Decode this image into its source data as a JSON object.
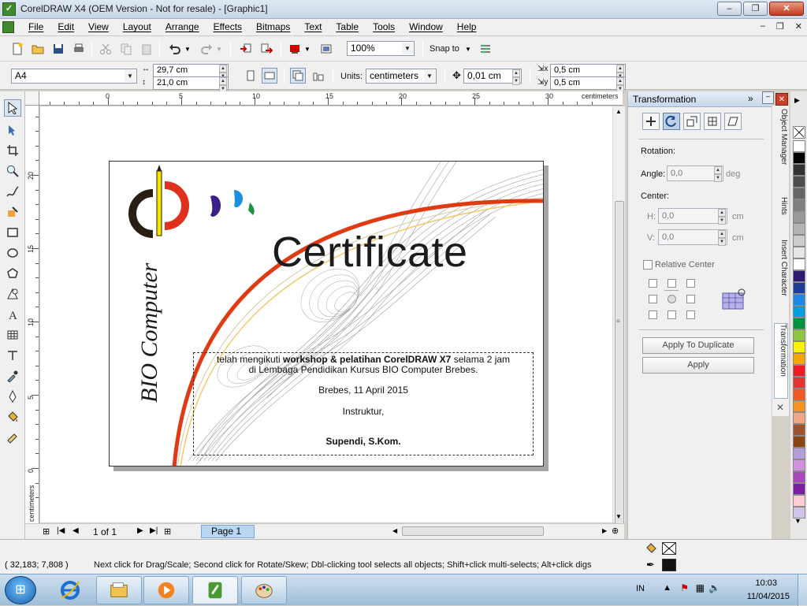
{
  "window": {
    "title": "CorelDRAW X4 (OEM Version - Not for resale) - [Graphic1]",
    "app_icon": "corel-logo-icon"
  },
  "menu": {
    "items": [
      "File",
      "Edit",
      "View",
      "Layout",
      "Arrange",
      "Effects",
      "Bitmaps",
      "Text",
      "Table",
      "Tools",
      "Window",
      "Help"
    ]
  },
  "toolbar": {
    "zoom": "100%",
    "snap_label": "Snap to"
  },
  "property_bar": {
    "paper": "A4",
    "width": "29,7 cm",
    "height": "21,0 cm",
    "units_label": "Units:",
    "units": "centimeters",
    "nudge": "0,01 cm",
    "dup_x": "0,5 cm",
    "dup_y": "0,5 cm"
  },
  "rulers": {
    "h_ticks": [
      "0",
      "5",
      "10",
      "15",
      "20",
      "25",
      "30"
    ],
    "v_ticks": [
      "20",
      "15",
      "10",
      "5",
      "0"
    ],
    "unit": "centimeters"
  },
  "certificate": {
    "logo_text": "BIO Computer",
    "heading": "Certificate",
    "line1_pre": "telah mengikuti ",
    "line1_bold": "workshop & pelatihan CorelDRAW X7",
    "line1_post": " selama 2 jam",
    "line2": "di Lembaga Pendidikan Kursus BIO Computer Brebes.",
    "place_date": "Brebes, 11 April 2015",
    "role": "Instruktur,",
    "signer": "Supendi, S.Kom."
  },
  "page_nav": {
    "counter": "1 of 1",
    "tab": "Page 1"
  },
  "docker": {
    "title": "Transformation",
    "rotation_label": "Rotation:",
    "angle_label": "Angle:",
    "angle_value": "0,0",
    "angle_unit": "deg",
    "center_label": "Center:",
    "h_label": "H:",
    "h_value": "0,0",
    "h_unit": "cm",
    "v_label": "V:",
    "v_value": "0,0",
    "v_unit": "cm",
    "relative_center": "Relative Center",
    "apply_dup": "Apply To Duplicate",
    "apply": "Apply"
  },
  "side_tabs": [
    "Object Manager",
    "Hints",
    "Insert Character",
    "Transformation"
  ],
  "palette": [
    "#ffffff",
    "#000000",
    "#333333",
    "#4d4d4d",
    "#666666",
    "#808080",
    "#999999",
    "#b3b3b3",
    "#cccccc",
    "#e6e6e6",
    "#ffffff",
    "#2e1a6e",
    "#1f3c96",
    "#1e88e5",
    "#00a0e0",
    "#00923f",
    "#8dc63f",
    "#fff200",
    "#f7a600",
    "#ed1c24",
    "#e3342f",
    "#f15a24",
    "#f7931e",
    "#f4a582",
    "#a0522d",
    "#8b4513",
    "#b39ddb",
    "#ce93d8",
    "#ab47bc",
    "#7b1fa2",
    "#ffcdd2",
    "#d1c4e9"
  ],
  "status": {
    "coords": "( 32,183; 7,808 )",
    "hint": "Next click for Drag/Scale; Second click for Rotate/Skew; Dbl-clicking tool selects all objects; Shift+click multi-selects; Alt+click digs"
  },
  "taskbar": {
    "lang": "IN",
    "time": "10:03",
    "date": "11/04/2015"
  }
}
